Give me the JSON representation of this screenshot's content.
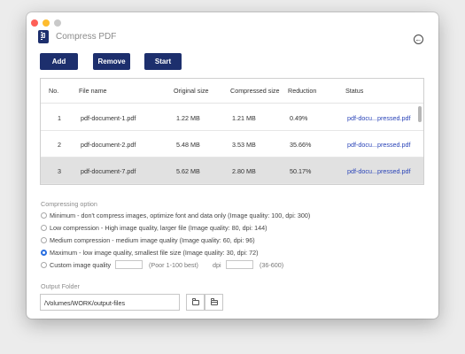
{
  "window": {
    "title": "Compress PDF"
  },
  "toolbar": {
    "add_label": "Add",
    "remove_label": "Remove",
    "start_label": "Start"
  },
  "table": {
    "headers": [
      "No.",
      "File name",
      "Original size",
      "Compressed size",
      "Reduction",
      "Status"
    ],
    "rows": [
      {
        "no": "1",
        "file": "pdf-document-1.pdf",
        "original": "1.22 MB",
        "compressed": "1.21 MB",
        "reduction": "0.49%",
        "status": "pdf-docu...pressed.pdf"
      },
      {
        "no": "2",
        "file": "pdf-document-2.pdf",
        "original": "5.48 MB",
        "compressed": "3.53 MB",
        "reduction": "35.66%",
        "status": "pdf-docu...pressed.pdf"
      },
      {
        "no": "3",
        "file": "pdf-document-7.pdf",
        "original": "5.62 MB",
        "compressed": "2.80 MB",
        "reduction": "50.17%",
        "status": "pdf-docu...pressed.pdf"
      }
    ],
    "selected_row": 3
  },
  "compressing": {
    "label": "Compressing option",
    "options": [
      "Minimum - don't compress images, optimize font and data only (Image quality: 100, dpi: 300)",
      "Low compression - High image quality, larger file (Image quality: 80, dpi: 144)",
      "Medium compression - medium image quality (Image quality: 60, dpi: 96)",
      "Maximum - low image quality, smallest file size (Image quality: 30, dpi: 72)",
      "Custom image quality"
    ],
    "selected_index": 3,
    "custom_quality_hint": "(Poor 1-100 best)",
    "dpi_label": "dpi",
    "dpi_hint": "(36-600)"
  },
  "output": {
    "label": "Output Folder",
    "path": "/Volumes/WORK/output-files"
  },
  "colors": {
    "accent": "#1d2f6d",
    "link": "#2a44b8",
    "radio_selected": "#2a6fe0"
  }
}
